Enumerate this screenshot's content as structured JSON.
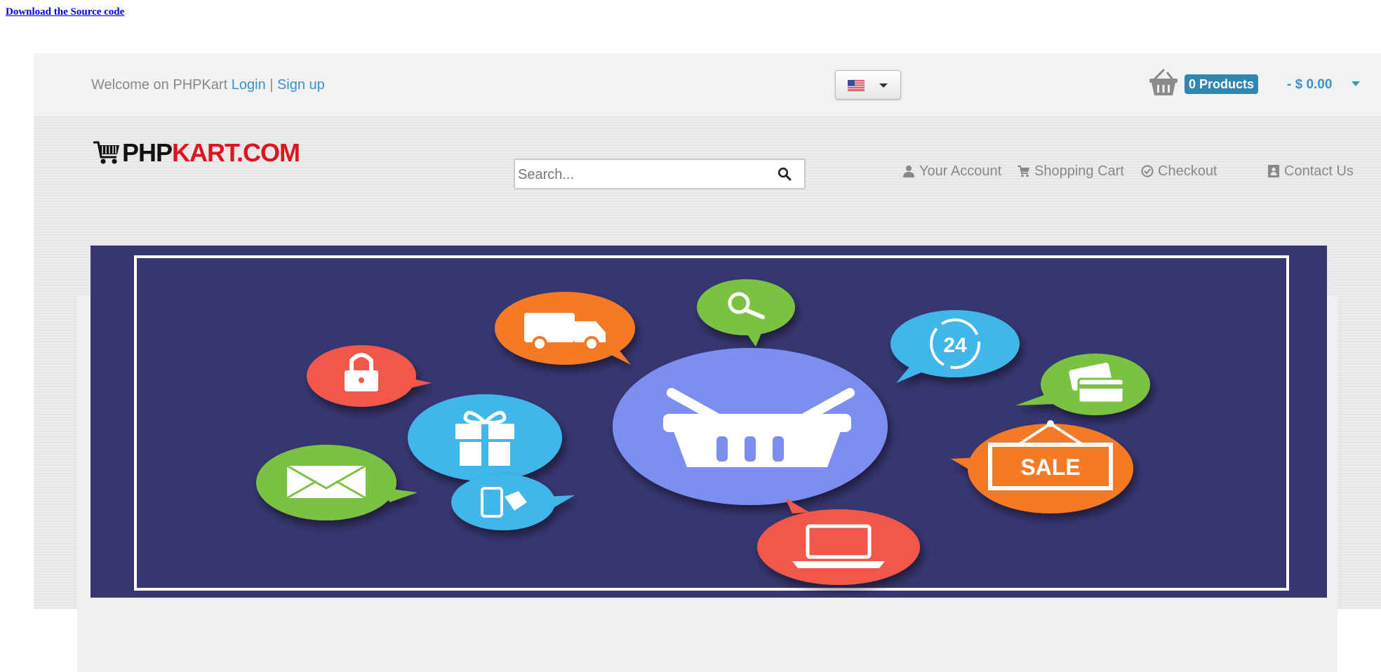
{
  "download_link": "Download the Source code",
  "topbar": {
    "welcome_text": "Welcome on PHPKart ",
    "login_label": "Login",
    "separator": " | ",
    "signup_label": "Sign up",
    "language": {
      "selected": "US flag (English)",
      "icon": "us-flag-icon"
    },
    "cart": {
      "icon": "basket-icon",
      "products_badge": "0 Products",
      "total": "- $ 0.00"
    }
  },
  "header": {
    "logo": {
      "part1": "PHP",
      "part2": "KART.COM",
      "icon": "shopping-cart-icon",
      "colors": {
        "part1": "#111111",
        "part2": "#e0141e"
      }
    },
    "search": {
      "placeholder": "Search...",
      "value": "",
      "icon": "search-icon"
    },
    "nav": [
      {
        "label": "Your Account",
        "icon": "user-icon"
      },
      {
        "label": "Shopping Cart",
        "icon": "cart-icon"
      },
      {
        "label": "Checkout",
        "icon": "check-circle-icon"
      },
      {
        "label": "Contact Us",
        "icon": "contact-book-icon"
      }
    ]
  },
  "banner": {
    "background": "#373670",
    "badges": [
      {
        "icon": "truck-icon",
        "color": "#f47a25"
      },
      {
        "icon": "magnifier-icon",
        "color": "#7bc242"
      },
      {
        "icon": "support-24-icon",
        "color": "#3fb6ea"
      },
      {
        "icon": "lock-icon",
        "color": "#f1594a"
      },
      {
        "icon": "credit-card-icon",
        "color": "#7bc242"
      },
      {
        "icon": "gift-icon",
        "color": "#3fb6ea"
      },
      {
        "icon": "basket-icon",
        "color": "#7b8ff0"
      },
      {
        "icon": "envelope-icon",
        "color": "#7bc242"
      },
      {
        "icon": "mobile-payment-icon",
        "color": "#3fb6ea"
      },
      {
        "icon": "sale-sign-icon",
        "color": "#f47a25",
        "text": "SALE"
      },
      {
        "icon": "laptop-icon",
        "color": "#f1594a"
      }
    ],
    "support_hours": "24"
  },
  "colors": {
    "link": "#3a94cc",
    "badge": "#2f86b1",
    "topbar_bg": "#f2f2f2",
    "header_bg": "#e8e8e8"
  }
}
